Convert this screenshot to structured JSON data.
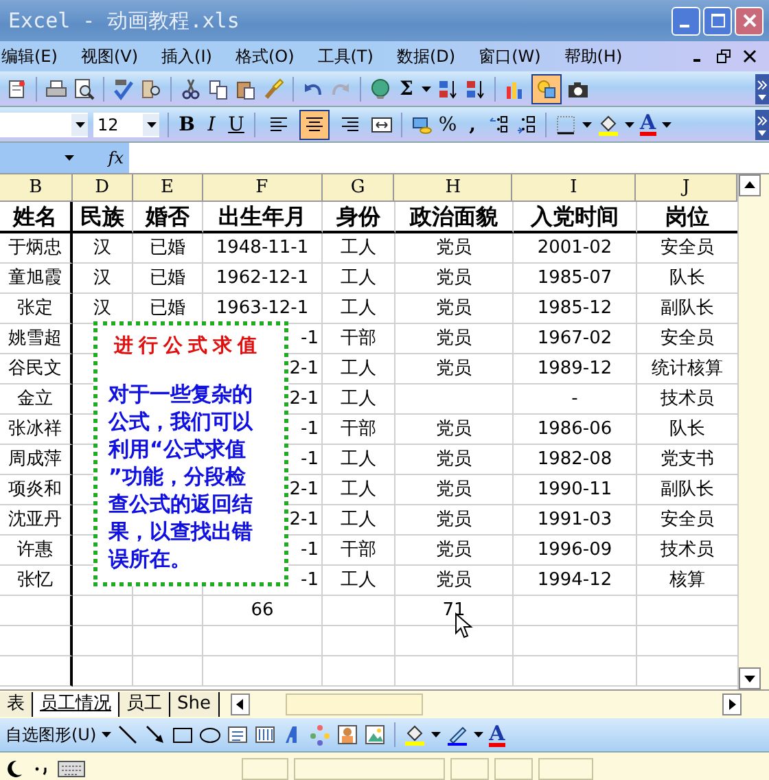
{
  "window": {
    "title": "Excel - 动画教程.xls"
  },
  "menu": [
    "编辑(E)",
    "视图(V)",
    "插入(I)",
    "格式(O)",
    "工具(T)",
    "数据(D)",
    "窗口(W)",
    "帮助(H)"
  ],
  "standard_toolbar": {
    "sum_symbol": "Σ",
    "drawing_selected": true
  },
  "formatting_toolbar": {
    "font_size": "12",
    "bold": "B",
    "italic": "I",
    "underline": "U",
    "percent": "%",
    "comma": ",",
    "font_color_letter": "A",
    "align": [
      {
        "selected": false
      },
      {
        "selected": true
      },
      {
        "selected": false
      }
    ]
  },
  "formula_bar": {
    "fx_label": "fx"
  },
  "columns": [
    "B",
    "D",
    "E",
    "F",
    "G",
    "H",
    "I",
    "J"
  ],
  "header_row": [
    "姓名",
    "民族",
    "婚否",
    "出生年月",
    "身份",
    "政治面貌",
    "入党时间",
    "岗位"
  ],
  "rows": [
    {
      "name": "于炳忠",
      "ethnic": "汉",
      "married": "已婚",
      "born": "1948-11-1",
      "status": "工人",
      "party": "党员",
      "joined": "2001-02",
      "post": "安全员"
    },
    {
      "name": "童旭霞",
      "ethnic": "汉",
      "married": "已婚",
      "born": "1962-12-1",
      "status": "工人",
      "party": "党员",
      "joined": "1985-07",
      "post": "队长"
    },
    {
      "name": "张定",
      "ethnic": "汉",
      "married": "已婚",
      "born": "1963-12-1",
      "status": "工人",
      "party": "党员",
      "joined": "1985-12",
      "post": "副队长"
    },
    {
      "name": "姚雪超",
      "born": "-1",
      "status": "干部",
      "party": "党员",
      "joined": "1967-02",
      "post": "安全员"
    },
    {
      "name": "谷民文",
      "born": "2-1",
      "status": "工人",
      "party": "党员",
      "joined": "1989-12",
      "post": "统计核算"
    },
    {
      "name": "金立",
      "born": "2-1",
      "status": "工人",
      "joined": "-",
      "post": "技术员"
    },
    {
      "name": "张冰祥",
      "born": "-1",
      "status": "干部",
      "party": "党员",
      "joined": "1986-06",
      "post": "队长"
    },
    {
      "name": "周成萍",
      "born": "-1",
      "status": "工人",
      "party": "党员",
      "joined": "1982-08",
      "post": "党支书"
    },
    {
      "name": "项炎和",
      "born": "2-1",
      "status": "工人",
      "party": "党员",
      "joined": "1990-11",
      "post": "副队长"
    },
    {
      "name": "沈亚丹",
      "born": "2-1",
      "status": "工人",
      "party": "党员",
      "joined": "1991-03",
      "post": "安全员"
    },
    {
      "name": "许惠",
      "born": "-1",
      "status": "干部",
      "party": "党员",
      "joined": "1996-09",
      "post": "技术员"
    },
    {
      "name": "张忆",
      "born": "-1",
      "status": "工人",
      "party": "党员",
      "joined": "1994-12",
      "post": "核算"
    }
  ],
  "totals": {
    "born": "66",
    "party": "71"
  },
  "callout": {
    "title": "进行公式求值",
    "body": "对于一些复杂的公式，我们可以利用“公式求值”功能，分段检查公式的返回结果，以查找出错误所在。"
  },
  "sheet_tabs": [
    {
      "label": "表",
      "selected": false
    },
    {
      "label": "员工情况",
      "selected": true
    },
    {
      "label": "员工",
      "selected": false
    },
    {
      "label": "She",
      "selected": false
    }
  ],
  "drawing_toolbar": {
    "autoshapes_label": "自选图形(U)",
    "font_color_letter": "A"
  }
}
